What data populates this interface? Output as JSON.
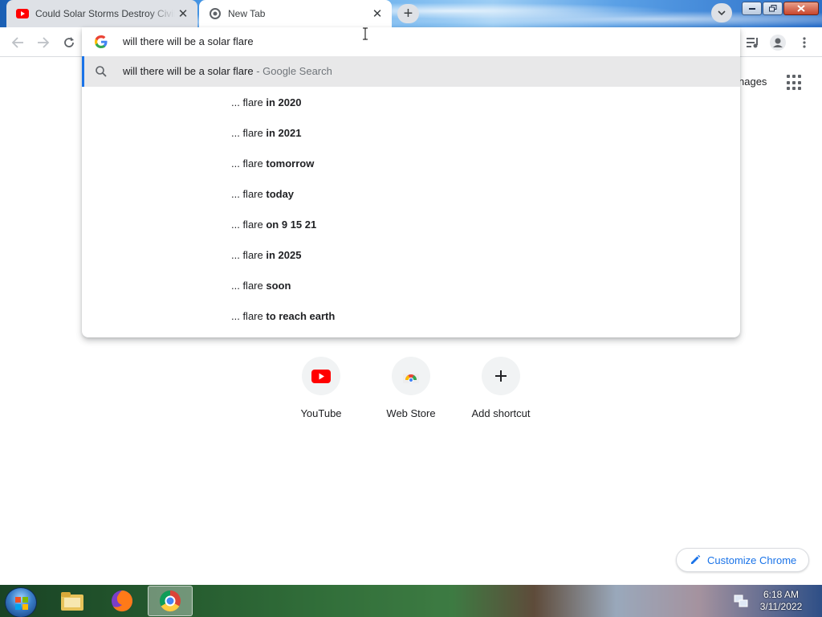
{
  "browser": {
    "tabs": [
      {
        "title": "Could Solar Storms Destroy Civili",
        "favicon": "youtube-icon",
        "active": false
      },
      {
        "title": "New Tab",
        "favicon": "chrome-icon",
        "active": true
      }
    ]
  },
  "omnibox": {
    "query": "will there will be a solar flare",
    "first_suggestion": {
      "text": "will there will be a solar flare",
      "suffix": " - Google Search"
    },
    "suggestions": [
      {
        "prefix": "... flare ",
        "completion": "in 2020"
      },
      {
        "prefix": "... flare ",
        "completion": "in 2021"
      },
      {
        "prefix": "... flare ",
        "completion": "tomorrow"
      },
      {
        "prefix": "... flare ",
        "completion": "today"
      },
      {
        "prefix": "... flare ",
        "completion": "on 9 15 21"
      },
      {
        "prefix": "... flare ",
        "completion": "in 2025"
      },
      {
        "prefix": "... flare ",
        "completion": "soon"
      },
      {
        "prefix": "... flare ",
        "completion": "to reach earth"
      }
    ]
  },
  "ntp": {
    "images_link": "nages",
    "shortcuts": [
      {
        "label": "YouTube",
        "icon": "youtube-icon"
      },
      {
        "label": "Web Store",
        "icon": "web-store-icon"
      },
      {
        "label": "Add shortcut",
        "icon": "plus-icon"
      }
    ],
    "customize_label": "Customize Chrome"
  },
  "taskbar": {
    "time": "6:18 AM",
    "date": "3/11/2022"
  },
  "colors": {
    "accent": "#1a73e8",
    "youtube_red": "#ff0000"
  }
}
